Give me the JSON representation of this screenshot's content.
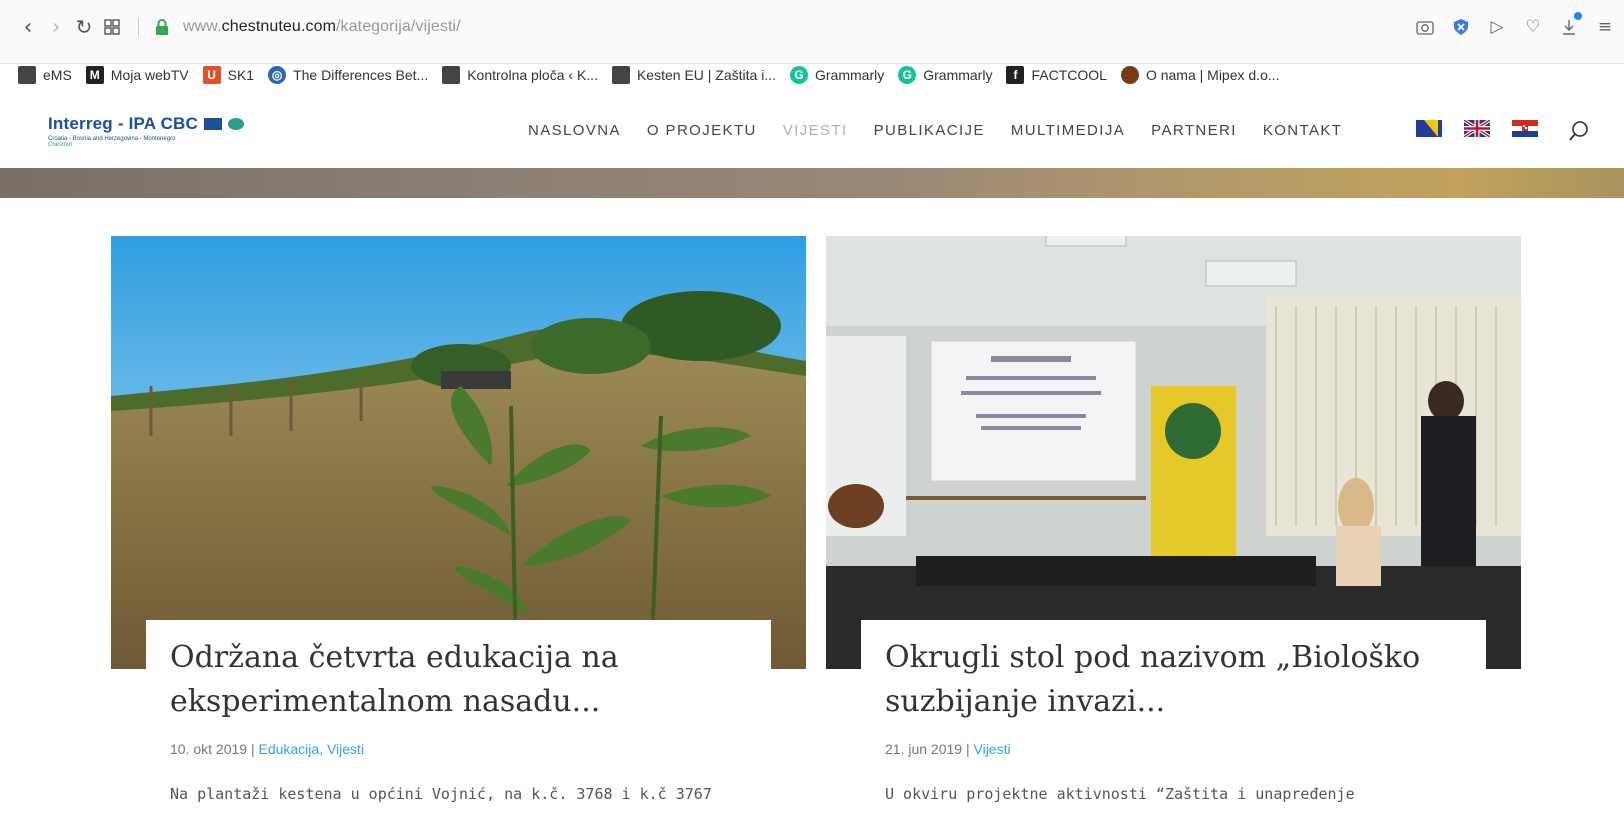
{
  "browser": {
    "url_prefix": "www.",
    "url_domain": "chestnuteu.com",
    "url_path": "/kategorija/vijesti/",
    "bookmarks": [
      {
        "label": "eMS",
        "icon": "page-icon",
        "color": "#444444"
      },
      {
        "label": "Moja webTV",
        "icon": "mw-icon",
        "color": "#222222"
      },
      {
        "label": "SK1",
        "icon": "sk1-icon",
        "color": "#e0502a"
      },
      {
        "label": "The Differences Bet...",
        "icon": "globe-icon",
        "color": "#2b6aa8"
      },
      {
        "label": "Kontrolna ploča ‹ K...",
        "icon": "page-icon",
        "color": "#444444"
      },
      {
        "label": "Kesten EU | Zaštita i...",
        "icon": "page-icon",
        "color": "#444444"
      },
      {
        "label": "Grammarly",
        "icon": "grammarly-icon",
        "color": "#15c39a"
      },
      {
        "label": "Grammarly",
        "icon": "grammarly-icon",
        "color": "#15c39a"
      },
      {
        "label": "FACTCOOL",
        "icon": "f-icon",
        "color": "#222222"
      },
      {
        "label": "O nama | Mipex d.o...",
        "icon": "chestnut-icon",
        "color": "#7a3b12"
      }
    ]
  },
  "site": {
    "logo_title": "Interreg - IPA CBC",
    "logo_sub": "Croatia - Bosnia and Herzegovina - Montenegro",
    "logo_sub2": "Chestnut",
    "menu": [
      "NASLOVNA",
      "O PROJEKTU",
      "VIJESTI",
      "PUBLIKACIJE",
      "MULTIMEDIJA",
      "PARTNERI",
      "KONTAKT"
    ],
    "active_menu": "VIJESTI",
    "flags": [
      "bosnia-flag",
      "uk-flag",
      "croatia-flag"
    ]
  },
  "posts": [
    {
      "title_line1": "Održana četvrta edukacija na",
      "title_line2": "eksperimentalnom nasadu...",
      "date": "10. okt 2019",
      "separator": " | ",
      "category1": "Edukacija",
      "category_sep": ", ",
      "category2": "Vijesti",
      "excerpt": "Na plantaži kestena u općini Vojnić, na k.č. 3768 i k.č 3767"
    },
    {
      "title_line1": "Okrugli stol pod nazivom „Biološko",
      "title_line2": "suzbijanje invazi...",
      "date": "21. jun 2019",
      "separator": " | ",
      "category1": "Vijesti",
      "excerpt": "U okviru projektne aktivnosti “Zaštita i unapređenje"
    }
  ]
}
